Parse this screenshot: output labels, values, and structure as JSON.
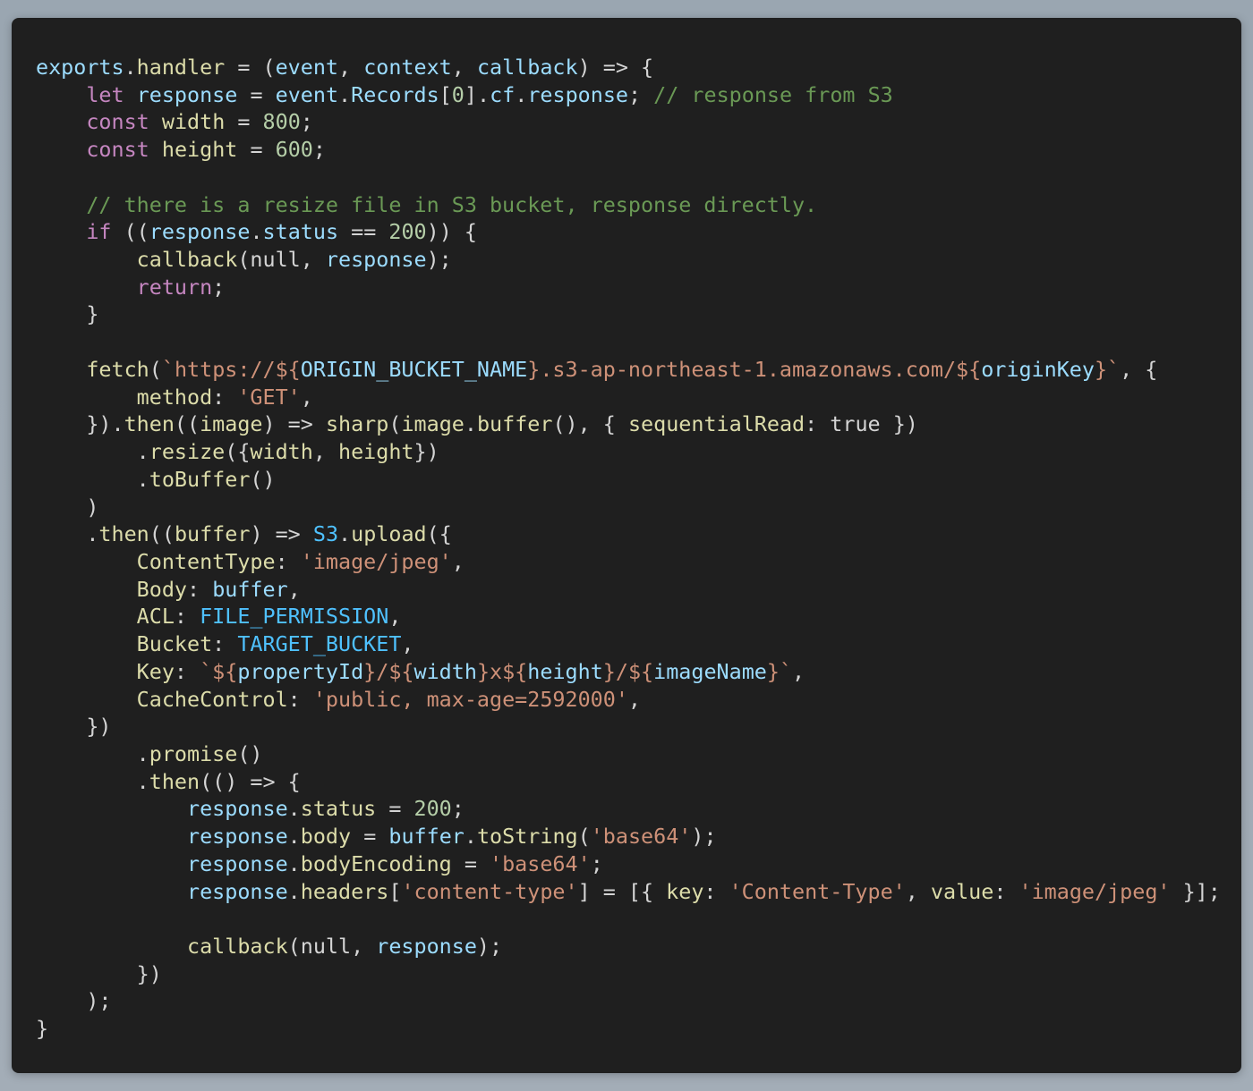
{
  "colors": {
    "background": "#1f1f1f",
    "plain": "#d4d4d4",
    "variable": "#9cdcfe",
    "keyword": "#c586c0",
    "function": "#dcdcaa",
    "number": "#b5cea8",
    "string": "#ce9178",
    "comment": "#6a9955",
    "constant": "#4fc1ff"
  },
  "code": {
    "language": "javascript",
    "lines": [
      [
        [
          "var",
          "exports"
        ],
        [
          "plain",
          "."
        ],
        [
          "fn",
          "handler"
        ],
        [
          "plain",
          " = ("
        ],
        [
          "var",
          "event"
        ],
        [
          "plain",
          ", "
        ],
        [
          "var",
          "context"
        ],
        [
          "plain",
          ", "
        ],
        [
          "var",
          "callback"
        ],
        [
          "plain",
          ") => {"
        ]
      ],
      [
        [
          "plain",
          "    "
        ],
        [
          "kw",
          "let"
        ],
        [
          "plain",
          " "
        ],
        [
          "var",
          "response"
        ],
        [
          "plain",
          " = "
        ],
        [
          "var",
          "event"
        ],
        [
          "plain",
          "."
        ],
        [
          "var",
          "Records"
        ],
        [
          "plain",
          "["
        ],
        [
          "num",
          "0"
        ],
        [
          "plain",
          "]."
        ],
        [
          "var",
          "cf"
        ],
        [
          "plain",
          "."
        ],
        [
          "var",
          "response"
        ],
        [
          "plain",
          "; "
        ],
        [
          "cmt",
          "// response from S3"
        ]
      ],
      [
        [
          "plain",
          "    "
        ],
        [
          "kw",
          "const"
        ],
        [
          "plain",
          " "
        ],
        [
          "fn",
          "width"
        ],
        [
          "plain",
          " = "
        ],
        [
          "num",
          "800"
        ],
        [
          "plain",
          ";"
        ]
      ],
      [
        [
          "plain",
          "    "
        ],
        [
          "kw",
          "const"
        ],
        [
          "plain",
          " "
        ],
        [
          "fn",
          "height"
        ],
        [
          "plain",
          " = "
        ],
        [
          "num",
          "600"
        ],
        [
          "plain",
          ";"
        ]
      ],
      [],
      [
        [
          "plain",
          "    "
        ],
        [
          "cmt",
          "// there is a resize file in S3 bucket, response directly."
        ]
      ],
      [
        [
          "plain",
          "    "
        ],
        [
          "kw",
          "if"
        ],
        [
          "plain",
          " (("
        ],
        [
          "var",
          "response"
        ],
        [
          "plain",
          "."
        ],
        [
          "var",
          "status"
        ],
        [
          "plain",
          " == "
        ],
        [
          "num",
          "200"
        ],
        [
          "plain",
          ")) {"
        ]
      ],
      [
        [
          "plain",
          "        "
        ],
        [
          "fn",
          "callback"
        ],
        [
          "plain",
          "(null, "
        ],
        [
          "var",
          "response"
        ],
        [
          "plain",
          ");"
        ]
      ],
      [
        [
          "plain",
          "        "
        ],
        [
          "kw",
          "return"
        ],
        [
          "plain",
          ";"
        ]
      ],
      [
        [
          "plain",
          "    }"
        ]
      ],
      [],
      [
        [
          "plain",
          "    "
        ],
        [
          "fn",
          "fetch"
        ],
        [
          "plain",
          "("
        ],
        [
          "str",
          "`https://${"
        ],
        [
          "var",
          "ORIGIN_BUCKET_NAME"
        ],
        [
          "str",
          "}.s3-ap-northeast-1.amazonaws.com/${"
        ],
        [
          "var",
          "originKey"
        ],
        [
          "str",
          "}`"
        ],
        [
          "plain",
          ", {"
        ]
      ],
      [
        [
          "plain",
          "        "
        ],
        [
          "fn",
          "method"
        ],
        [
          "plain",
          ": "
        ],
        [
          "str",
          "'GET'"
        ],
        [
          "plain",
          ","
        ]
      ],
      [
        [
          "plain",
          "    })."
        ],
        [
          "fn",
          "then"
        ],
        [
          "plain",
          "(("
        ],
        [
          "fn",
          "image"
        ],
        [
          "plain",
          ") => "
        ],
        [
          "fn",
          "sharp"
        ],
        [
          "plain",
          "("
        ],
        [
          "fn",
          "image"
        ],
        [
          "plain",
          "."
        ],
        [
          "fn",
          "buffer"
        ],
        [
          "plain",
          "(), { "
        ],
        [
          "fn",
          "sequentialRead"
        ],
        [
          "plain",
          ": true })"
        ]
      ],
      [
        [
          "plain",
          "        ."
        ],
        [
          "fn",
          "resize"
        ],
        [
          "plain",
          "({"
        ],
        [
          "fn",
          "width"
        ],
        [
          "plain",
          ", "
        ],
        [
          "fn",
          "height"
        ],
        [
          "plain",
          "})"
        ]
      ],
      [
        [
          "plain",
          "        ."
        ],
        [
          "fn",
          "toBuffer"
        ],
        [
          "plain",
          "()"
        ]
      ],
      [
        [
          "plain",
          "    )"
        ]
      ],
      [
        [
          "plain",
          "    ."
        ],
        [
          "fn",
          "then"
        ],
        [
          "plain",
          "(("
        ],
        [
          "fn",
          "buffer"
        ],
        [
          "plain",
          ") => "
        ],
        [
          "const",
          "S3"
        ],
        [
          "plain",
          "."
        ],
        [
          "fn",
          "upload"
        ],
        [
          "plain",
          "({"
        ]
      ],
      [
        [
          "plain",
          "        "
        ],
        [
          "fn",
          "ContentType"
        ],
        [
          "plain",
          ": "
        ],
        [
          "str",
          "'image/jpeg'"
        ],
        [
          "plain",
          ","
        ]
      ],
      [
        [
          "plain",
          "        "
        ],
        [
          "fn",
          "Body"
        ],
        [
          "plain",
          ": "
        ],
        [
          "var",
          "buffer"
        ],
        [
          "plain",
          ","
        ]
      ],
      [
        [
          "plain",
          "        "
        ],
        [
          "fn",
          "ACL"
        ],
        [
          "plain",
          ": "
        ],
        [
          "const",
          "FILE_PERMISSION"
        ],
        [
          "plain",
          ","
        ]
      ],
      [
        [
          "plain",
          "        "
        ],
        [
          "fn",
          "Bucket"
        ],
        [
          "plain",
          ": "
        ],
        [
          "const",
          "TARGET_BUCKET"
        ],
        [
          "plain",
          ","
        ]
      ],
      [
        [
          "plain",
          "        "
        ],
        [
          "fn",
          "Key"
        ],
        [
          "plain",
          ": "
        ],
        [
          "str",
          "`${"
        ],
        [
          "var",
          "propertyId"
        ],
        [
          "str",
          "}/${"
        ],
        [
          "var",
          "width"
        ],
        [
          "str",
          "}x${"
        ],
        [
          "var",
          "height"
        ],
        [
          "str",
          "}/${"
        ],
        [
          "var",
          "imageName"
        ],
        [
          "str",
          "}`"
        ],
        [
          "plain",
          ","
        ]
      ],
      [
        [
          "plain",
          "        "
        ],
        [
          "fn",
          "CacheControl"
        ],
        [
          "plain",
          ": "
        ],
        [
          "str",
          "'public, max-age=2592000'"
        ],
        [
          "plain",
          ","
        ]
      ],
      [
        [
          "plain",
          "    })"
        ]
      ],
      [
        [
          "plain",
          "        ."
        ],
        [
          "fn",
          "promise"
        ],
        [
          "plain",
          "()"
        ]
      ],
      [
        [
          "plain",
          "        ."
        ],
        [
          "fn",
          "then"
        ],
        [
          "plain",
          "(() => {"
        ]
      ],
      [
        [
          "plain",
          "            "
        ],
        [
          "var",
          "response"
        ],
        [
          "plain",
          "."
        ],
        [
          "fn",
          "status"
        ],
        [
          "plain",
          " = "
        ],
        [
          "num",
          "200"
        ],
        [
          "plain",
          ";"
        ]
      ],
      [
        [
          "plain",
          "            "
        ],
        [
          "var",
          "response"
        ],
        [
          "plain",
          "."
        ],
        [
          "fn",
          "body"
        ],
        [
          "plain",
          " = "
        ],
        [
          "var",
          "buffer"
        ],
        [
          "plain",
          "."
        ],
        [
          "fn",
          "toString"
        ],
        [
          "plain",
          "("
        ],
        [
          "str",
          "'base64'"
        ],
        [
          "plain",
          ");"
        ]
      ],
      [
        [
          "plain",
          "            "
        ],
        [
          "var",
          "response"
        ],
        [
          "plain",
          "."
        ],
        [
          "fn",
          "bodyEncoding"
        ],
        [
          "plain",
          " = "
        ],
        [
          "str",
          "'base64'"
        ],
        [
          "plain",
          ";"
        ]
      ],
      [
        [
          "plain",
          "            "
        ],
        [
          "var",
          "response"
        ],
        [
          "plain",
          "."
        ],
        [
          "fn",
          "headers"
        ],
        [
          "plain",
          "["
        ],
        [
          "str",
          "'content-type'"
        ],
        [
          "plain",
          "] = [{ "
        ],
        [
          "fn",
          "key"
        ],
        [
          "plain",
          ": "
        ],
        [
          "str",
          "'Content-Type'"
        ],
        [
          "plain",
          ", "
        ],
        [
          "fn",
          "value"
        ],
        [
          "plain",
          ": "
        ],
        [
          "str",
          "'image/jpeg'"
        ],
        [
          "plain",
          " }];"
        ]
      ],
      [],
      [
        [
          "plain",
          "            "
        ],
        [
          "fn",
          "callback"
        ],
        [
          "plain",
          "(null, "
        ],
        [
          "var",
          "response"
        ],
        [
          "plain",
          ");"
        ]
      ],
      [
        [
          "plain",
          "        })"
        ]
      ],
      [
        [
          "plain",
          "    );"
        ]
      ],
      [
        [
          "plain",
          "}"
        ]
      ]
    ]
  }
}
